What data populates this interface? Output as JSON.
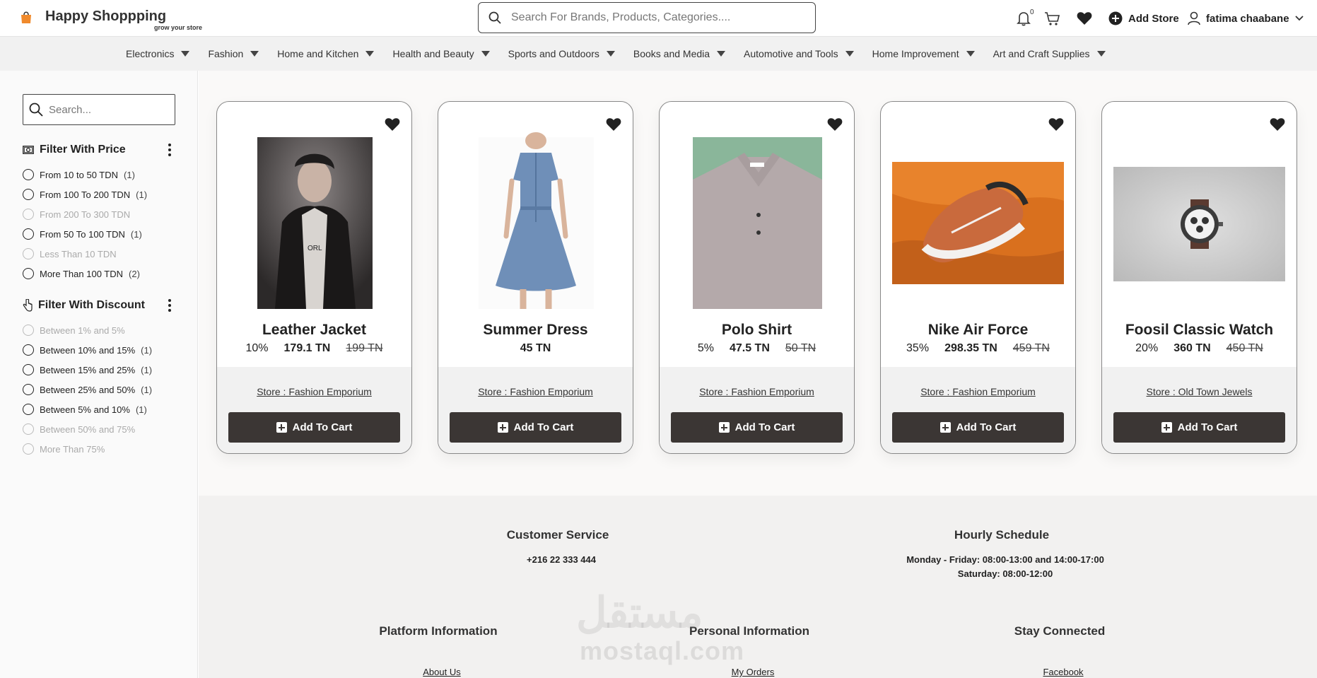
{
  "header": {
    "title": "Happy Shoppping",
    "tagline": "grow your store",
    "search_placeholder": "Search For Brands, Products, Categories....",
    "notification_count": "0",
    "add_store_label": "Add Store",
    "user_name": "fatima chaabane"
  },
  "categories": [
    "Electronics",
    "Fashion",
    "Home and Kitchen",
    "Health and Beauty",
    "Sports and Outdoors",
    "Books and Media",
    "Automotive and Tools",
    "Home Improvement",
    "Art and Craft Supplies"
  ],
  "sidebar": {
    "search_placeholder": "Search...",
    "price_filter": {
      "title": "Filter With Price",
      "options": [
        {
          "label": "From 10 to 50 TDN",
          "count": "(1)",
          "disabled": false
        },
        {
          "label": "From 100 To 200 TDN",
          "count": "(1)",
          "disabled": false
        },
        {
          "label": "From 200 To 300 TDN",
          "count": "",
          "disabled": true
        },
        {
          "label": "From 50 To 100 TDN",
          "count": "(1)",
          "disabled": false
        },
        {
          "label": "Less Than 10 TDN",
          "count": "",
          "disabled": true
        },
        {
          "label": "More Than 100 TDN",
          "count": "(2)",
          "disabled": false
        }
      ]
    },
    "discount_filter": {
      "title": "Filter With Discount",
      "options": [
        {
          "label": "Between 1% and 5%",
          "count": "",
          "disabled": true
        },
        {
          "label": "Between 10% and 15%",
          "count": "(1)",
          "disabled": false
        },
        {
          "label": "Between 15% and 25%",
          "count": "(1)",
          "disabled": false
        },
        {
          "label": "Between 25% and 50%",
          "count": "(1)",
          "disabled": false
        },
        {
          "label": "Between 5% and 10%",
          "count": "(1)",
          "disabled": false
        },
        {
          "label": "Between 50% and 75%",
          "count": "",
          "disabled": true
        },
        {
          "label": "More Than 75%",
          "count": "",
          "disabled": true
        }
      ]
    }
  },
  "products": [
    {
      "name": "Leather Jacket",
      "discount": "10%",
      "price": "179.1 TN",
      "old_price": "199 TN",
      "store": "Store : Fashion Emporium",
      "button": "Add To Cart",
      "image": "man-in-leather-jacket",
      "image_color": "#3d3a3a"
    },
    {
      "name": "Summer Dress",
      "discount": "",
      "price": "45 TN",
      "old_price": "",
      "store": "Store : Fashion Emporium",
      "button": "Add To Cart",
      "image": "denim-dress",
      "image_color": "#6f8fb8"
    },
    {
      "name": "Polo Shirt",
      "discount": "5%",
      "price": "47.5 TN",
      "old_price": "50 TN",
      "store": "Store : Fashion Emporium",
      "button": "Add To Cart",
      "image": "polo-shirt",
      "image_color": "#8ab69a"
    },
    {
      "name": "Nike Air Force",
      "discount": "35%",
      "price": "298.35 TN",
      "old_price": "459 TN",
      "store": "Store : Fashion Emporium",
      "button": "Add To Cart",
      "image": "sneaker-on-orange",
      "image_color": "#d9701e"
    },
    {
      "name": "Foosil Classic Watch",
      "discount": "20%",
      "price": "360 TN",
      "old_price": "450 TN",
      "store": "Store : Old Town Jewels",
      "button": "Add To Cart",
      "image": "wrist-watch",
      "image_color": "#c9c9c9"
    }
  ],
  "footer": {
    "customer_service": {
      "title": "Customer Service",
      "phone": "+216 22 333 444"
    },
    "hourly_schedule": {
      "title": "Hourly Schedule",
      "line1": "Monday - Friday: 08:00-13:00 and 14:00-17:00",
      "line2": "Saturday: 08:00-12:00"
    },
    "platform_info": {
      "title": "Platform Information",
      "link": "About Us"
    },
    "personal_info": {
      "title": "Personal Information",
      "link": "My Orders"
    },
    "stay_connected": {
      "title": "Stay Connected",
      "link": "Facebook"
    }
  },
  "watermark": {
    "arabic": "مستقل",
    "latin": "mostaql.com"
  }
}
